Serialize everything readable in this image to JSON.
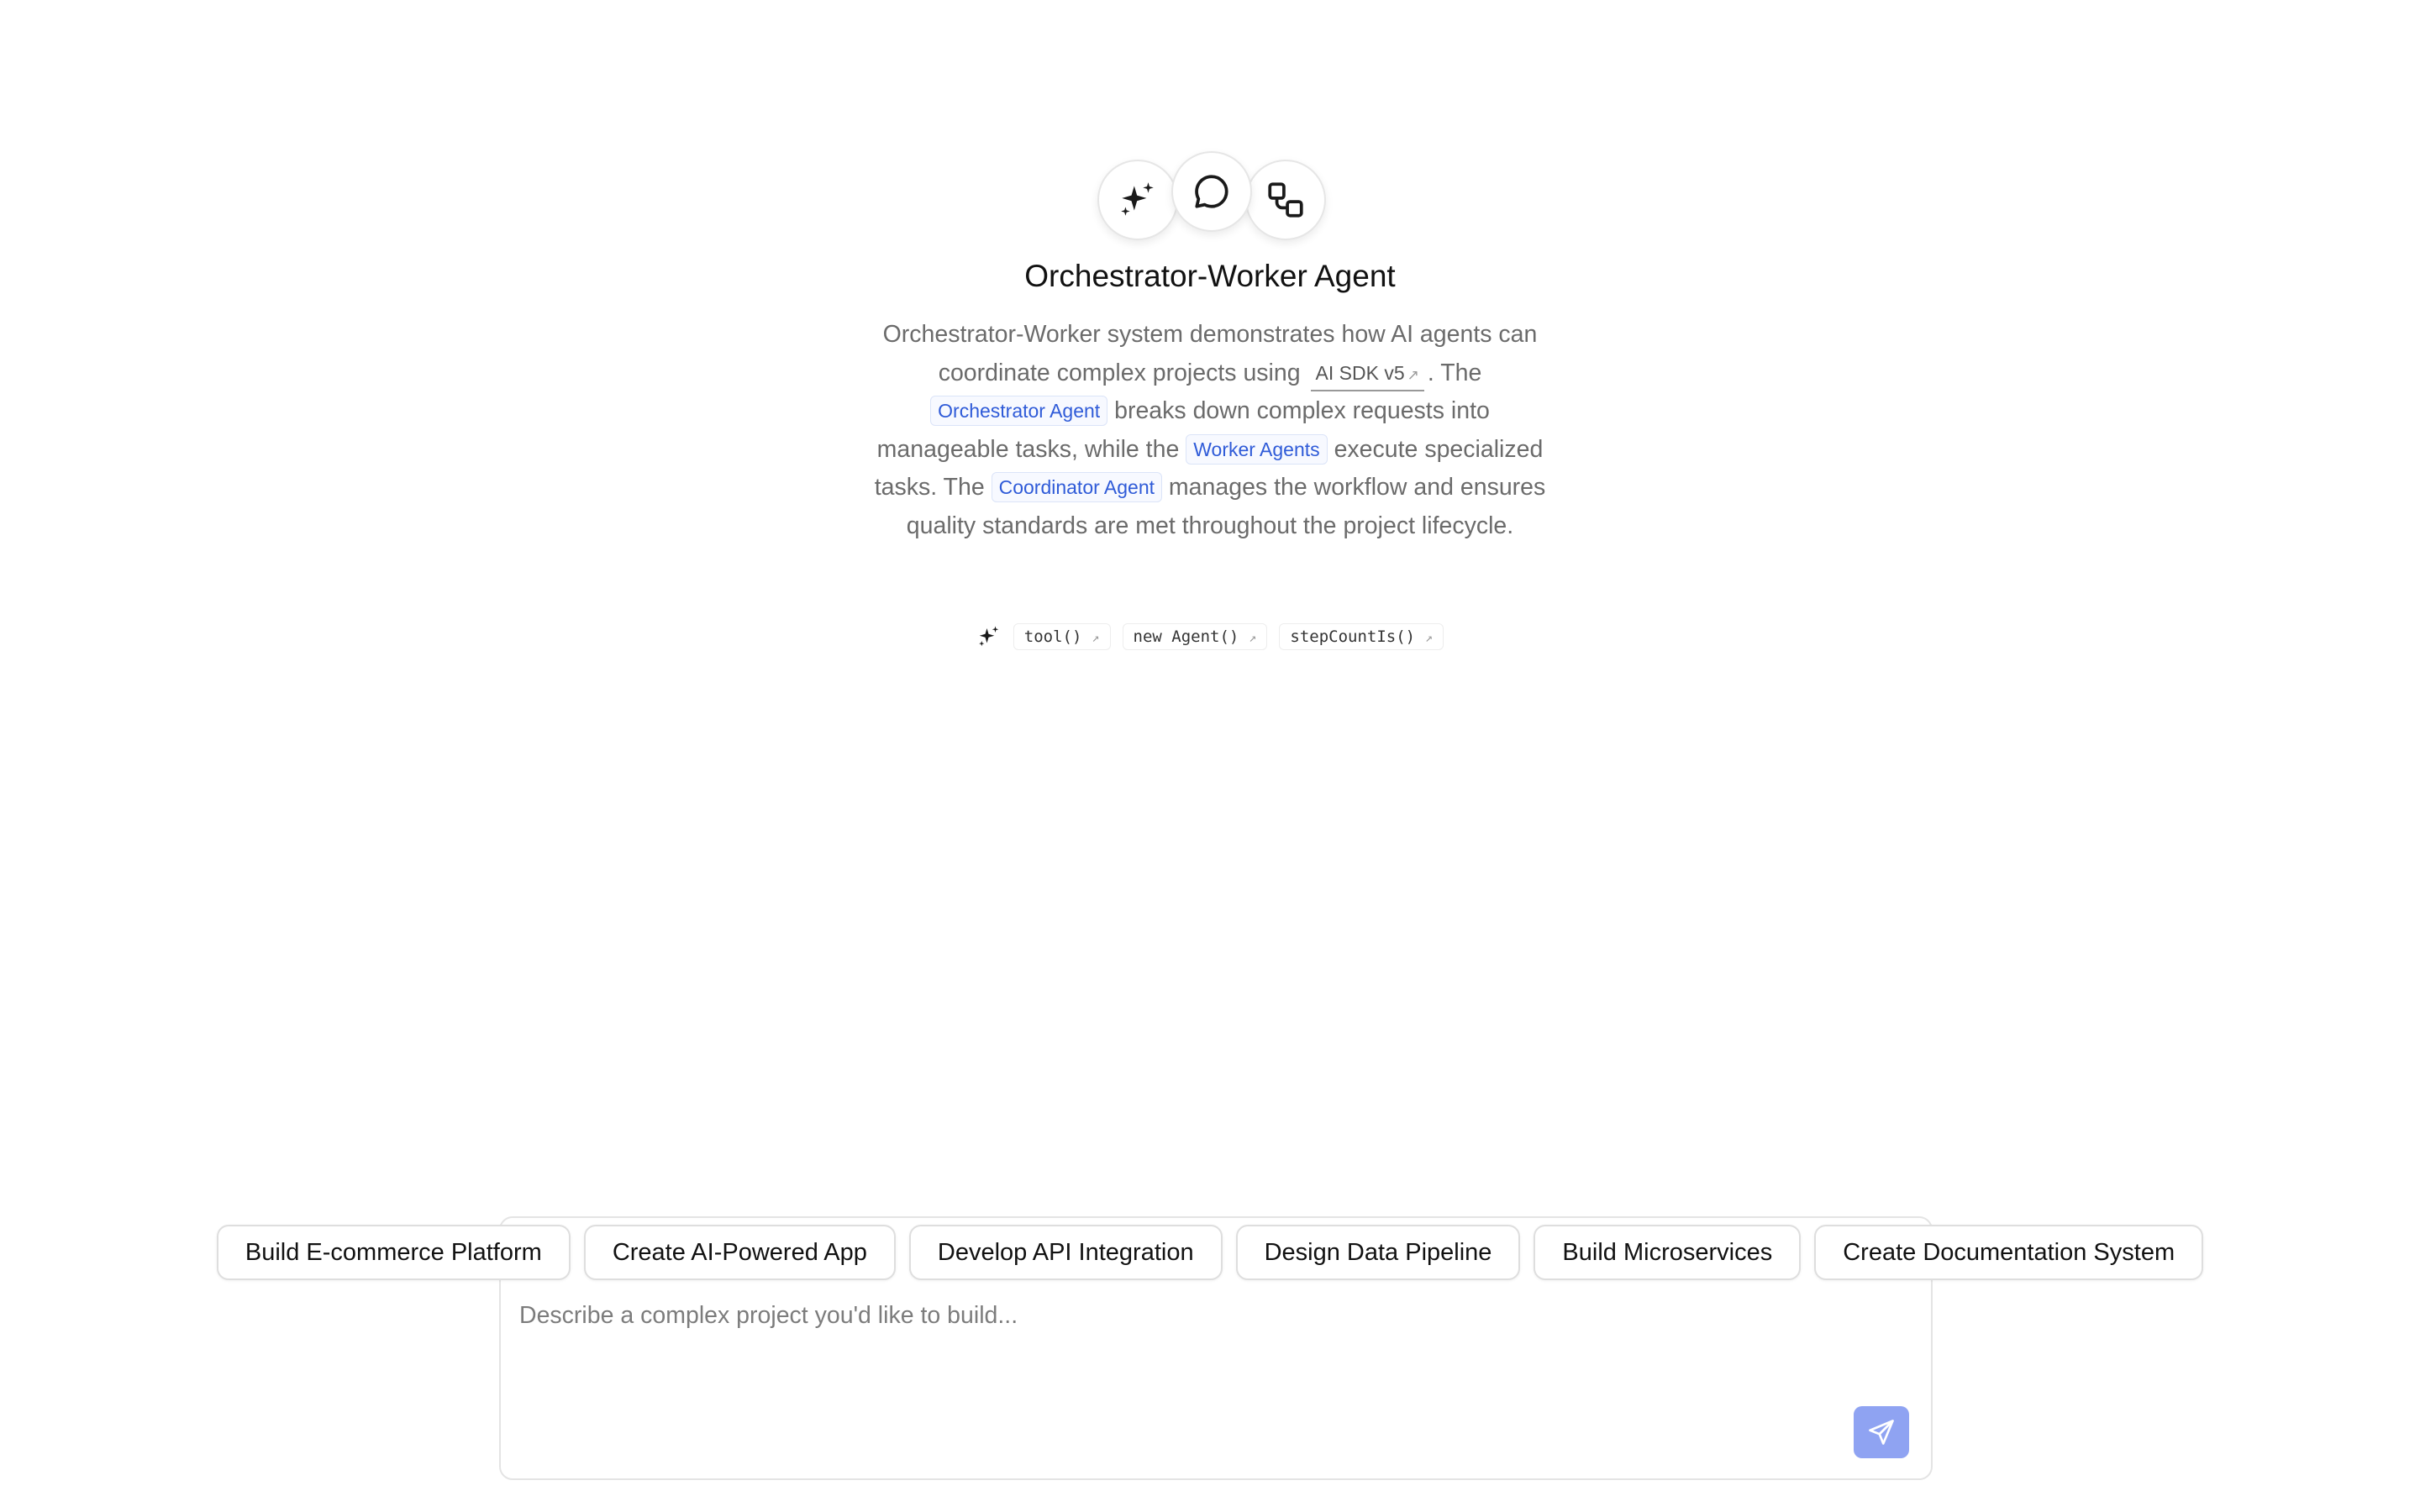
{
  "hero": {
    "icons": [
      "sparkles-icon",
      "chat-bubble-icon",
      "workflow-icon"
    ],
    "title": "Orchestrator-Worker Agent"
  },
  "description": {
    "p1": "Orchestrator-Worker system demonstrates how AI agents can coordinate complex projects using",
    "sdk_link": "AI SDK v5",
    "p2": ". The",
    "pill_orchestrator": "Orchestrator Agent",
    "p3": "breaks down complex requests into manageable tasks, while the",
    "pill_worker": "Worker Agents",
    "p4": "execute specialized tasks. The",
    "pill_coordinator": "Coordinator Agent",
    "p5": "manages the workflow and ensures quality standards are met throughout the project lifecycle."
  },
  "code_links": [
    {
      "label": "tool()"
    },
    {
      "label": "new Agent()"
    },
    {
      "label": "stepCountIs()"
    }
  ],
  "suggestions": [
    "Build E-commerce Platform",
    "Create AI-Powered App",
    "Develop API Integration",
    "Design Data Pipeline",
    "Build Microservices",
    "Create Documentation System"
  ],
  "composer": {
    "placeholder": "Describe a complex project you'd like to build...",
    "value": ""
  },
  "colors": {
    "accent_blue": "#2f5bd8",
    "send_button": "#8fa3f2",
    "muted_text": "#6b6b6b"
  }
}
